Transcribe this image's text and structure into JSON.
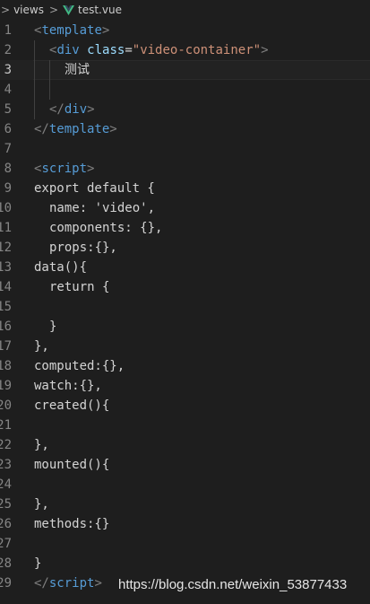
{
  "breadcrumb": {
    "items": [
      "views",
      "test.vue"
    ]
  },
  "editor": {
    "current_line": 3,
    "lines": [
      {
        "n": "1",
        "indent": 0,
        "tokens": [
          [
            "t-bracket",
            "<"
          ],
          [
            "t-tag",
            "template"
          ],
          [
            "t-bracket",
            ">"
          ]
        ]
      },
      {
        "n": "2",
        "indent": 1,
        "tokens": [
          [
            "t-bracket",
            "<"
          ],
          [
            "t-tag",
            "div"
          ],
          [
            "t-plain",
            " "
          ],
          [
            "t-attr",
            "class"
          ],
          [
            "t-plain",
            "="
          ],
          [
            "t-str",
            "\"video-container\""
          ],
          [
            "t-bracket",
            ">"
          ]
        ]
      },
      {
        "n": "3",
        "indent": 2,
        "tokens": [
          [
            "t-cjk",
            "测试"
          ]
        ]
      },
      {
        "n": "4",
        "indent": 0,
        "tokens": []
      },
      {
        "n": "5",
        "indent": 1,
        "tokens": [
          [
            "t-bracket",
            "</"
          ],
          [
            "t-tag",
            "div"
          ],
          [
            "t-bracket",
            ">"
          ]
        ]
      },
      {
        "n": "6",
        "indent": 0,
        "tokens": [
          [
            "t-bracket",
            "</"
          ],
          [
            "t-tag",
            "template"
          ],
          [
            "t-bracket",
            ">"
          ]
        ]
      },
      {
        "n": "7",
        "indent": 0,
        "tokens": []
      },
      {
        "n": "8",
        "indent": 0,
        "tokens": [
          [
            "t-bracket",
            "<"
          ],
          [
            "t-tag",
            "script"
          ],
          [
            "t-bracket",
            ">"
          ]
        ]
      },
      {
        "n": "9",
        "indent": 0,
        "tokens": [
          [
            "t-plain",
            "export default {"
          ]
        ]
      },
      {
        "n": "10",
        "indent": 1,
        "tokens": [
          [
            "t-plain",
            "name: 'video',"
          ]
        ]
      },
      {
        "n": "11",
        "indent": 1,
        "tokens": [
          [
            "t-plain",
            "components: {},"
          ]
        ]
      },
      {
        "n": "12",
        "indent": 1,
        "tokens": [
          [
            "t-plain",
            "props:{},"
          ]
        ]
      },
      {
        "n": "13",
        "indent": 0,
        "tokens": [
          [
            "t-plain",
            "data(){"
          ]
        ]
      },
      {
        "n": "14",
        "indent": 1,
        "tokens": [
          [
            "t-plain",
            "return {"
          ]
        ]
      },
      {
        "n": "15",
        "indent": 0,
        "tokens": []
      },
      {
        "n": "16",
        "indent": 1,
        "tokens": [
          [
            "t-plain",
            "}"
          ]
        ]
      },
      {
        "n": "17",
        "indent": 0,
        "tokens": [
          [
            "t-plain",
            "},"
          ]
        ]
      },
      {
        "n": "18",
        "indent": 0,
        "tokens": [
          [
            "t-plain",
            "computed:{},"
          ]
        ]
      },
      {
        "n": "19",
        "indent": 0,
        "tokens": [
          [
            "t-plain",
            "watch:{},"
          ]
        ]
      },
      {
        "n": "20",
        "indent": 0,
        "tokens": [
          [
            "t-plain",
            "created(){"
          ]
        ]
      },
      {
        "n": "21",
        "indent": 0,
        "tokens": []
      },
      {
        "n": "22",
        "indent": 0,
        "tokens": [
          [
            "t-plain",
            "},"
          ]
        ]
      },
      {
        "n": "23",
        "indent": 0,
        "tokens": [
          [
            "t-plain",
            "mounted(){"
          ]
        ]
      },
      {
        "n": "24",
        "indent": 0,
        "tokens": []
      },
      {
        "n": "25",
        "indent": 0,
        "tokens": [
          [
            "t-plain",
            "},"
          ]
        ]
      },
      {
        "n": "26",
        "indent": 0,
        "tokens": [
          [
            "t-plain",
            "methods:{}"
          ]
        ]
      },
      {
        "n": "27",
        "indent": 0,
        "tokens": []
      },
      {
        "n": "28",
        "indent": 0,
        "tokens": [
          [
            "t-plain",
            "}"
          ]
        ]
      },
      {
        "n": "29",
        "indent": 0,
        "tokens": [
          [
            "t-bracket",
            "</"
          ],
          [
            "t-tag",
            "script"
          ],
          [
            "t-bracket",
            ">"
          ]
        ]
      }
    ]
  },
  "watermark": "https://blog.csdn.net/weixin_53877433",
  "colors": {
    "background": "#1e1e1e",
    "tag": "#569cd6",
    "attribute": "#9cdcfe",
    "string": "#ce9178",
    "punctuation": "#808080",
    "text": "#d4d4d4",
    "line_number": "#858585",
    "vue_icon": "#41b883"
  },
  "icons": [
    "chevron-right-icon",
    "vue-file-icon"
  ]
}
